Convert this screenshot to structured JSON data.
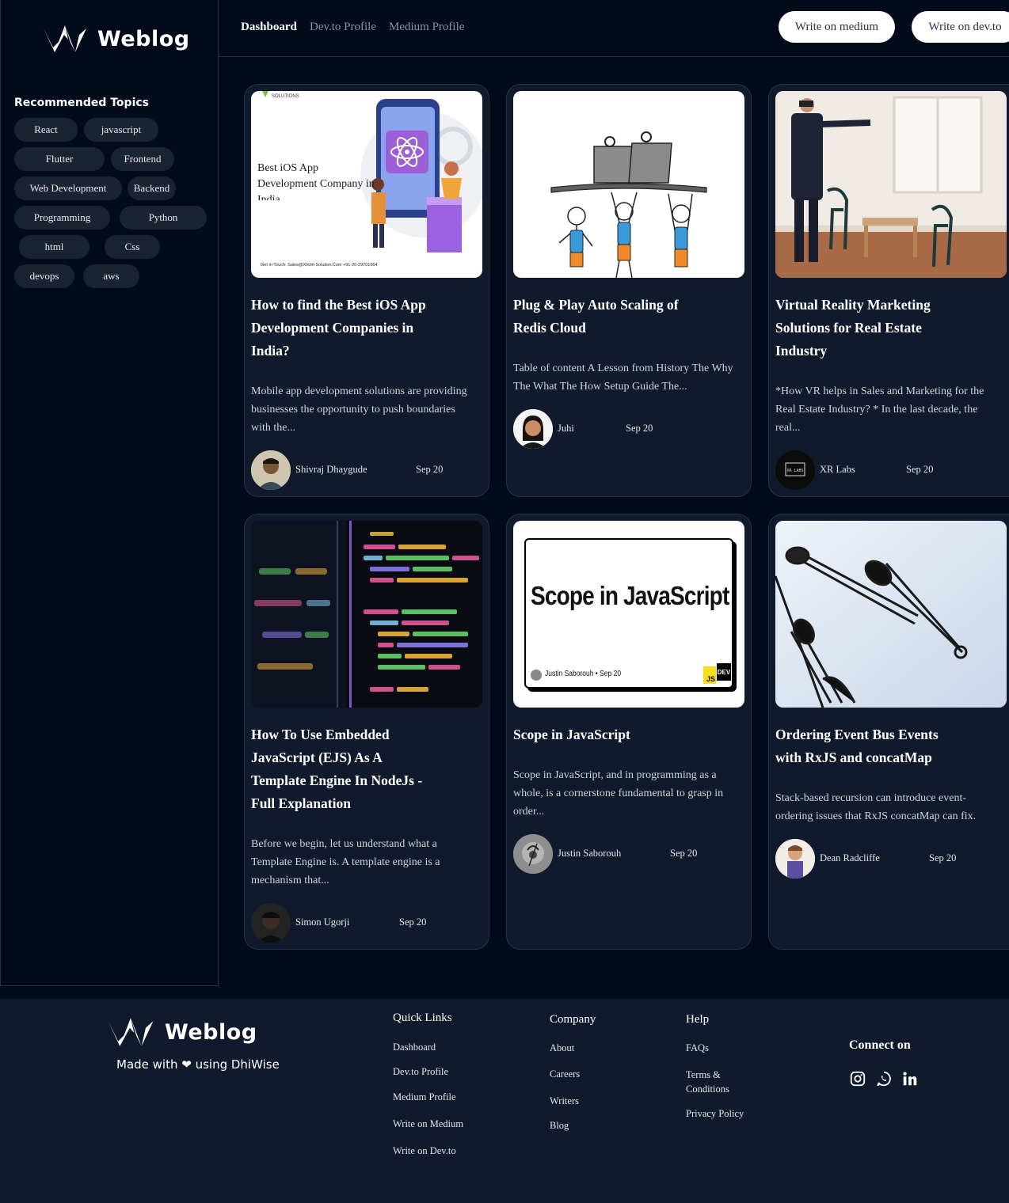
{
  "brand": {
    "name": "Weblog"
  },
  "sidebar": {
    "topics_title": "Recommended Topics",
    "topics": [
      "React",
      "javascript",
      "Flutter",
      "Frontend",
      "Web Development",
      "Backend",
      "Programming",
      "Python",
      "html",
      "Css",
      "devops",
      "aws"
    ]
  },
  "nav": {
    "links": [
      "Dashboard",
      "Dev.to Profile",
      "Medium Profile"
    ],
    "active": "Dashboard",
    "buttons": [
      "Write on medium",
      "Write on dev.to"
    ]
  },
  "posts": [
    {
      "title": "How to find the Best iOS App Development Companies in India?",
      "excerpt": "Mobile app development solutions are providing businesses the opportunity to push boundaries with the...",
      "author": "Shivraj Dhaygude",
      "date": "Sep 20",
      "thumb_text": "Best iOS App Development Company in India",
      "thumb_brand": "SOLUTIONS",
      "thumb_contact": "Get In Touch:  Sales@Xhtml-Solution.Com   +91-20-29701664"
    },
    {
      "title": "Plug & Play Auto Scaling of Redis Cloud",
      "excerpt": "Table of content A Lesson from History The Why The What The How Setup Guide The...",
      "author": "Juhi",
      "date": "Sep 20"
    },
    {
      "title": "Virtual Reality Marketing Solutions for Real Estate Industry",
      "excerpt": "*How VR helps in Sales and Marketing for the Real Estate Industry? * In the last decade, the real...",
      "author": "XR Labs",
      "date": "Sep 20",
      "avatar_text": "XR LABS"
    },
    {
      "title": "How To Use Embedded JavaScript (EJS) As A Template Engine In NodeJs - Full Explanation",
      "excerpt": "Before we begin, let us understand what a Template Engine is. A template engine is a mechanism that...",
      "author": "Simon Ugorji",
      "date": "Sep 20"
    },
    {
      "title": "Scope in JavaScript",
      "excerpt": "Scope in JavaScript, and in programming as a whole, is a cornerstone fundamental to grasp in order...",
      "author": "Justin Saborouh",
      "date": "Sep 20",
      "thumb_text": "Scope in JavaScript",
      "thumb_byline": "Justin Saborouh • Sep 20",
      "thumb_js": "JS",
      "thumb_dev": "DEV"
    },
    {
      "title": "Ordering Event Bus Events with RxJS and concatMap",
      "excerpt": "Stack-based recursion can introduce event-ordering issues that RxJS concatMap can fix.",
      "author": "Dean Radcliffe",
      "date": "Sep 20"
    }
  ],
  "footer": {
    "made_with": "Made with ❤ using DhiWise",
    "quick_links": {
      "title": "Quick Links",
      "items": [
        "Dashboard",
        "Dev.to Profile",
        "Medium Profile",
        "Write on Medium",
        "Write on Dev.to"
      ]
    },
    "company": {
      "title": "Company",
      "items": [
        "About",
        "Careers",
        "Writers",
        "Blog"
      ]
    },
    "help": {
      "title": "Help",
      "items": [
        "FAQs",
        "Terms & Conditions",
        "Privacy Policy"
      ]
    },
    "connect_title": "Connect on",
    "social": [
      "instagram-icon",
      "whatsapp-icon",
      "linkedin-icon"
    ]
  }
}
